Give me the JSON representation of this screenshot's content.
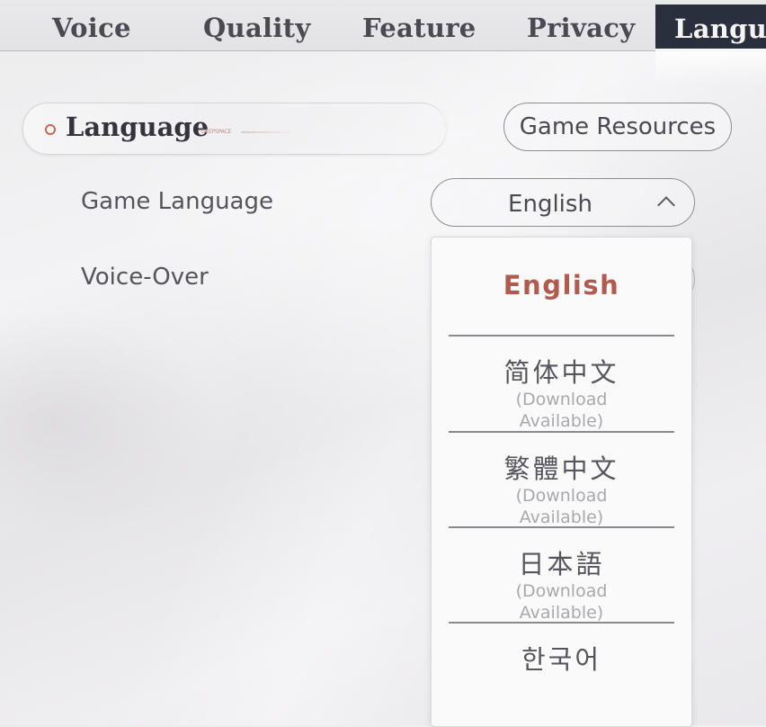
{
  "tabs": [
    {
      "label": "Voice",
      "active": false
    },
    {
      "label": "Quality",
      "active": false
    },
    {
      "label": "Feature",
      "active": false
    },
    {
      "label": "Privacy",
      "active": false
    },
    {
      "label": "Langu",
      "active": true
    }
  ],
  "section": {
    "title": "Language",
    "subtitle": "DEEPSPACE"
  },
  "game_resources_label": "Game Resources",
  "settings": {
    "game_language_label": "Game Language",
    "game_language_value": "English",
    "voice_over_label": "Voice-Over"
  },
  "dropdown": {
    "selected": "English",
    "options": [
      {
        "name": "简体中文",
        "note": "(Download\nAvailable)"
      },
      {
        "name": "繁體中文",
        "note": "(Download\nAvailable)"
      },
      {
        "name": "日本語",
        "note": "(Download\nAvailable)"
      },
      {
        "name": "한국어",
        "note": ""
      }
    ]
  },
  "colors": {
    "active_tab_bg": "#2a2f3d",
    "accent": "#b05b4e",
    "border": "#8e8d94"
  }
}
